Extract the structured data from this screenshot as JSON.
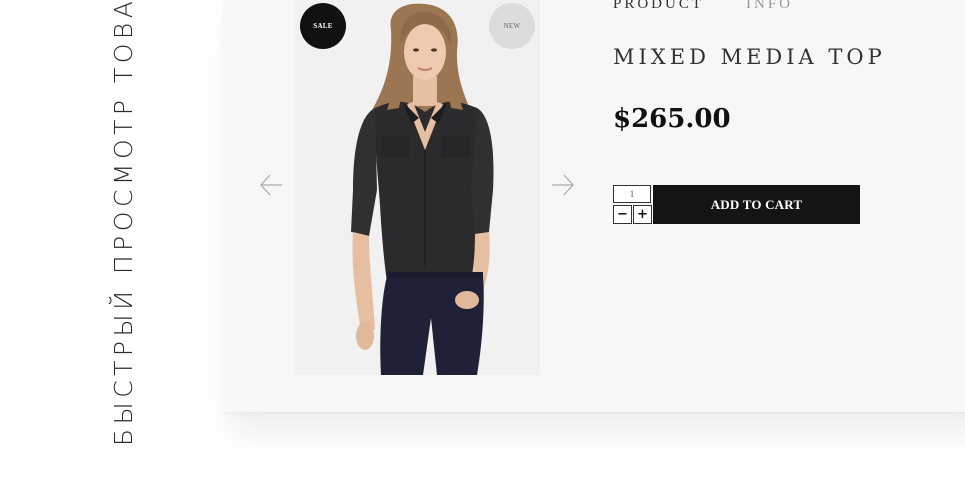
{
  "side_label": "БЫСТРЫЙ ПРОСМОТР ТОВАРА",
  "badges": {
    "sale": "SALE",
    "new": "NEW"
  },
  "tabs": [
    {
      "label": "PRODUCT",
      "active": true
    },
    {
      "label": "INFO",
      "active": false
    }
  ],
  "product": {
    "title": "MIXED MEDIA TOP",
    "price": "$265.00"
  },
  "quantity": {
    "value": "1",
    "minus_label": "−",
    "plus_label": "+"
  },
  "cart": {
    "button_label": "ADD TO CART"
  },
  "gallery": {
    "prev_icon": "arrow-left-icon",
    "next_icon": "arrow-right-icon"
  },
  "colors": {
    "button_bg": "#141414",
    "panel_bg": "#f7f7f7",
    "badge_sale": "#111111",
    "badge_new": "#dcdcdc",
    "shirt": "#2b2b2d",
    "jeans": "#1f2236"
  }
}
